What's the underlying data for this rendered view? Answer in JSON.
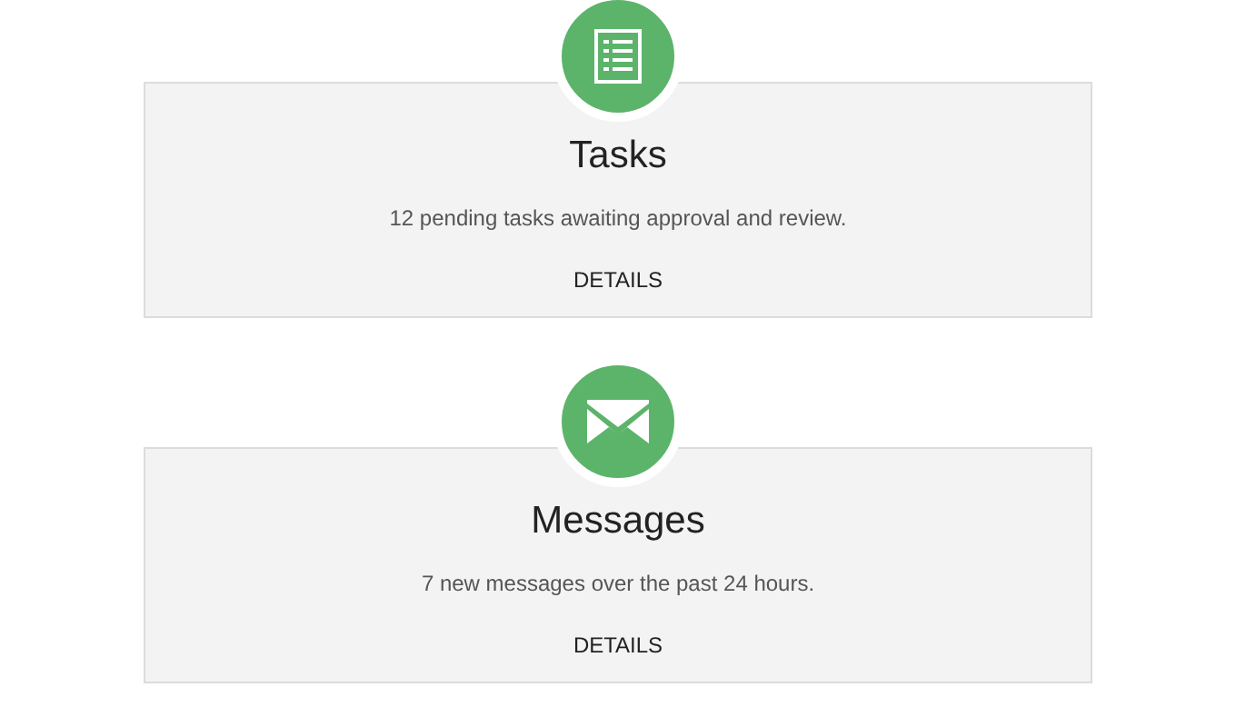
{
  "cards": [
    {
      "kind": "tasks",
      "title": "Tasks",
      "description": "12 pending tasks awaiting approval and review.",
      "link": "DETAILS"
    },
    {
      "kind": "messages",
      "title": "Messages",
      "description": "7 new messages over the past 24 hours.",
      "link": "DETAILS"
    }
  ]
}
